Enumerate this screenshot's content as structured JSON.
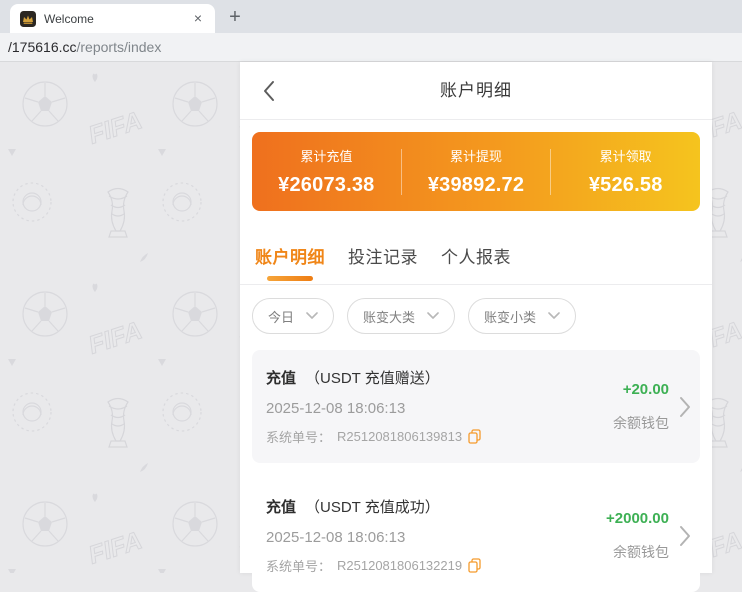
{
  "browser": {
    "tab_title": "Welcome",
    "close_glyph": "×",
    "newtab_glyph": "+",
    "url_host": "/175616.cc",
    "url_path": "/reports/index"
  },
  "header": {
    "title": "账户明细"
  },
  "stats": {
    "items": [
      {
        "label": "累计充值",
        "value": "¥26073.38"
      },
      {
        "label": "累计提现",
        "value": "¥39892.72"
      },
      {
        "label": "累计领取",
        "value": "¥526.58"
      }
    ]
  },
  "tabs": [
    {
      "label": "账户明细",
      "active": true
    },
    {
      "label": "投注记录",
      "active": false
    },
    {
      "label": "个人报表",
      "active": false
    }
  ],
  "filters": [
    {
      "label": "今日"
    },
    {
      "label": "账变大类"
    },
    {
      "label": "账变小类"
    }
  ],
  "transactions": [
    {
      "type": "充值",
      "subtype": "（USDT 充值赠送）",
      "datetime": "2025-12-08 18:06:13",
      "order_label": "系统单号：",
      "order_no": "R2512081806139813",
      "amount": "+20.00",
      "wallet": "余额钱包"
    },
    {
      "type": "充值",
      "subtype": "（USDT 充值成功）",
      "datetime": "2025-12-08 18:06:13",
      "order_label": "系统单号：",
      "order_no": "R2512081806132219",
      "amount": "+2000.00",
      "wallet": "余额钱包"
    }
  ],
  "colors": {
    "accent_orange": "#f08618",
    "card_gradient_start": "#ef701e",
    "card_gradient_end": "#f5c41e",
    "amount_green": "#3db054",
    "copy_icon_orange": "#f59b2c"
  }
}
